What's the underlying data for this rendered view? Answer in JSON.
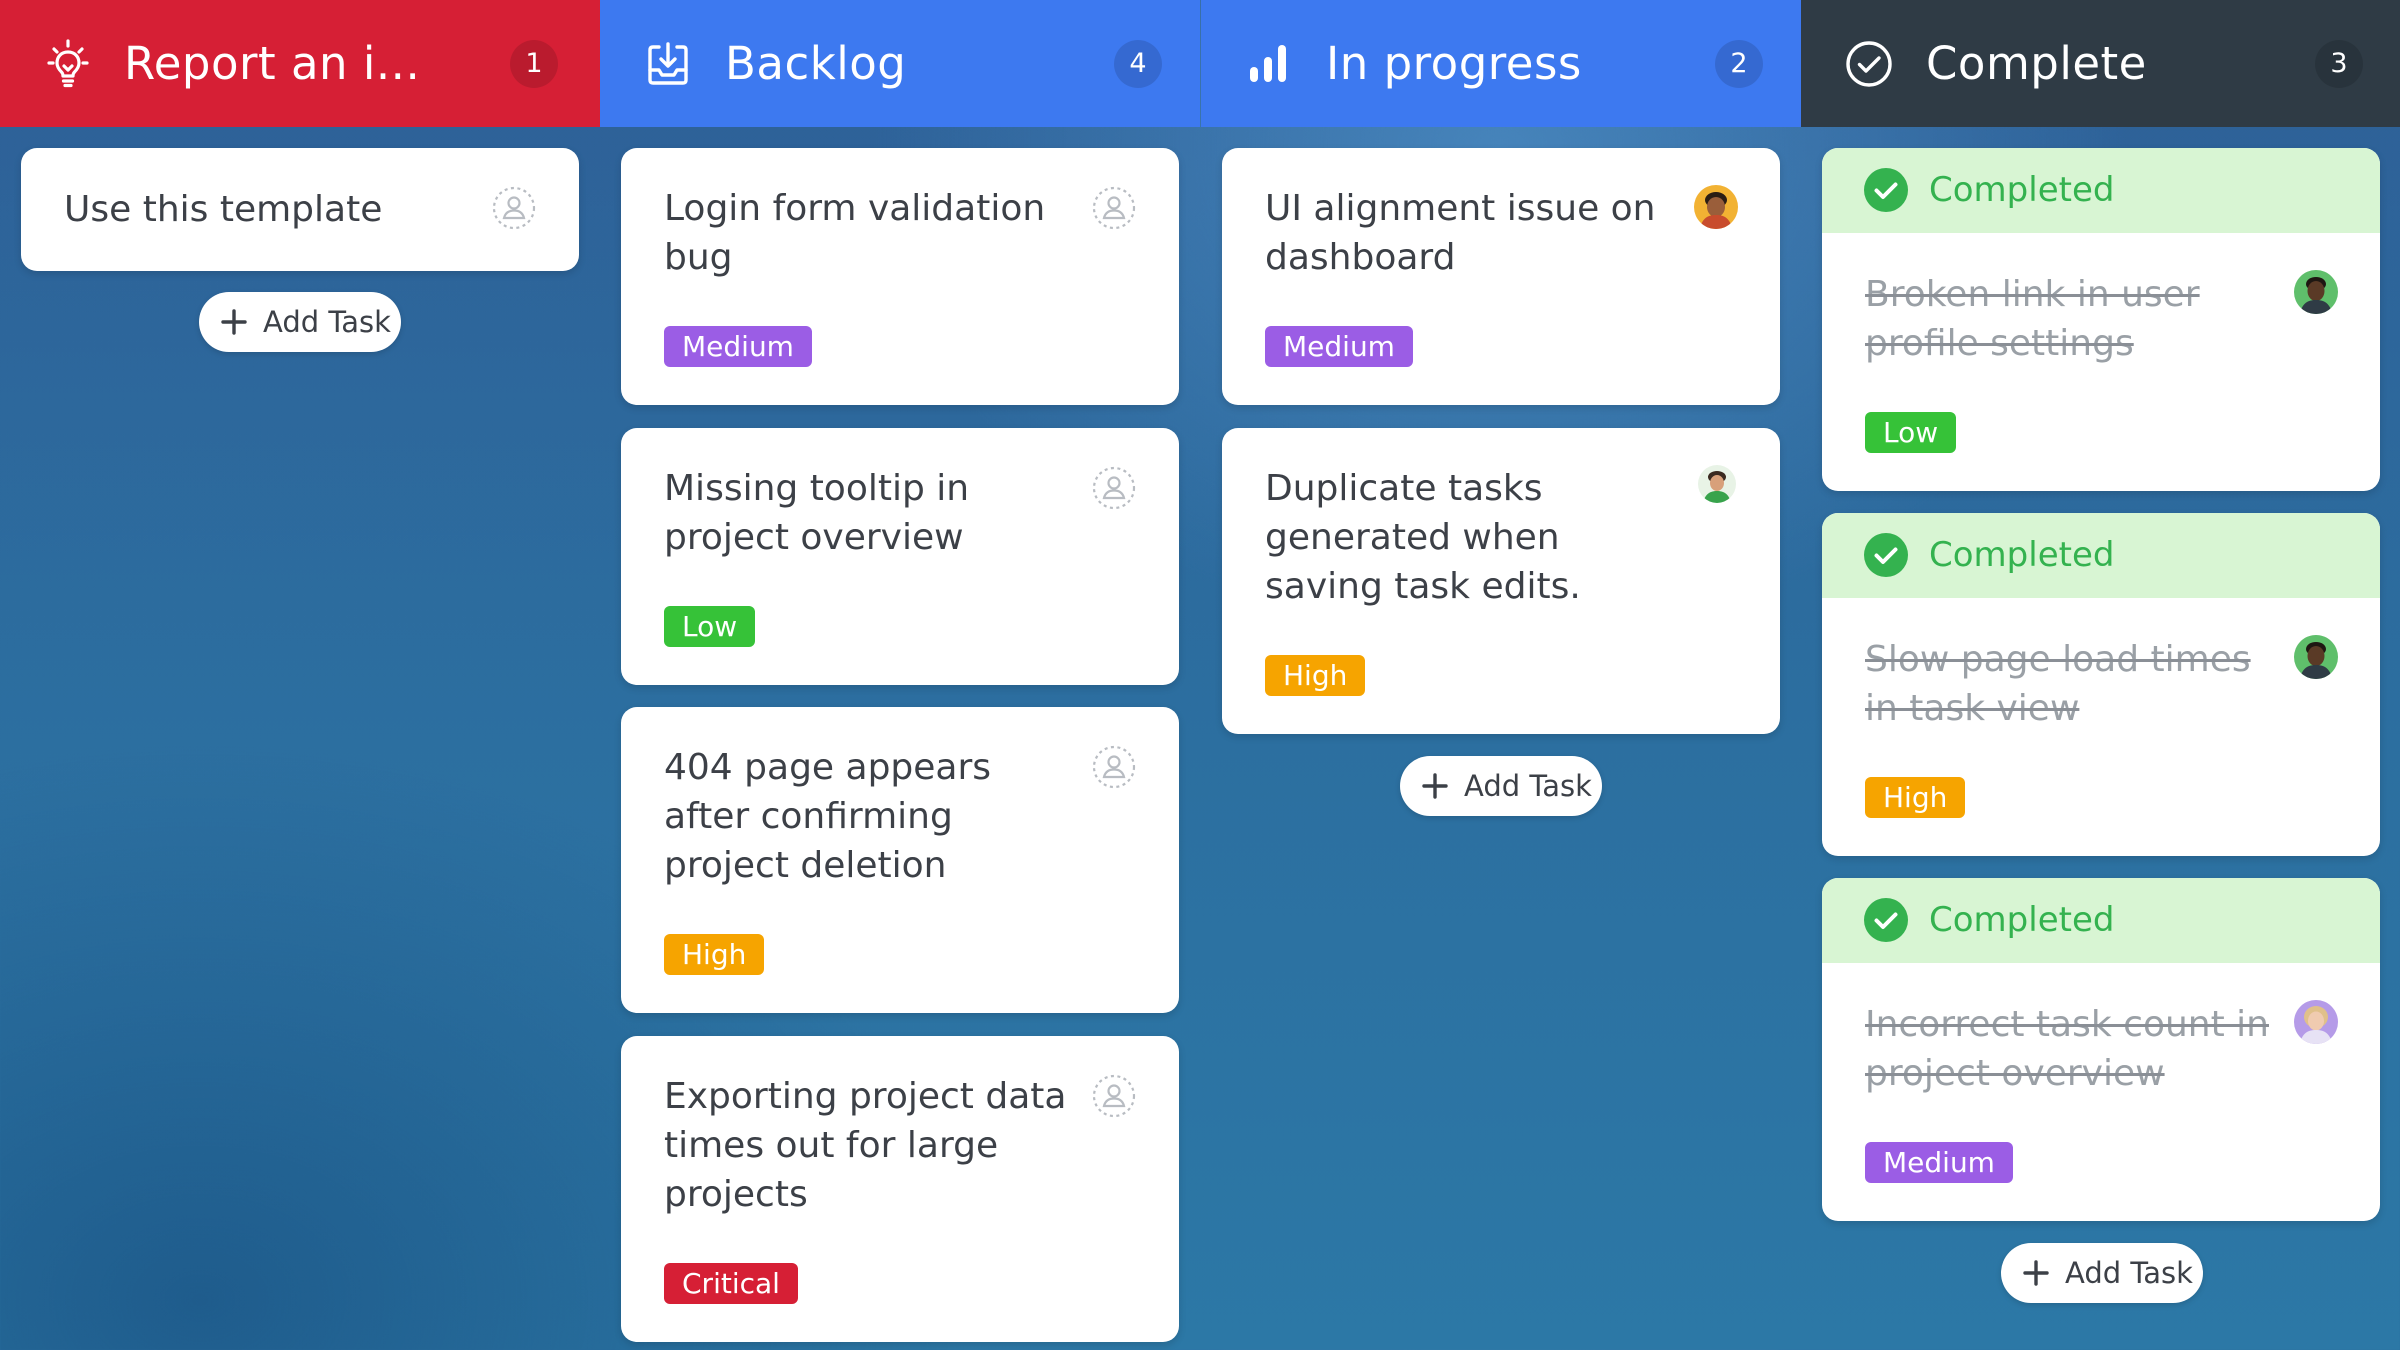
{
  "colors": {
    "report": "#d61f35",
    "backlog": "#3d79f0",
    "in_progress": "#3d79f0",
    "complete": "#2f3b45",
    "medium": "#9b5de5",
    "low": "#36c238",
    "high": "#f6a400",
    "critical": "#d61f35",
    "completed_banner": "#d8f5d3",
    "completed_text": "#34b24f"
  },
  "columns": [
    {
      "title": "Report an i...",
      "count": "1",
      "icon": "lightbulb-icon",
      "cards": [
        {
          "title": "Use this template",
          "assignee": "unassigned"
        }
      ],
      "add_task": "Add Task"
    },
    {
      "title": "Backlog",
      "count": "4",
      "icon": "inbox-download-icon",
      "cards": [
        {
          "title": "Login form validation bug",
          "priority": "Medium",
          "assignee": "unassigned"
        },
        {
          "title": "Missing tooltip in project overview",
          "priority": "Low",
          "assignee": "unassigned"
        },
        {
          "title": "404 page appears after confirming project deletion",
          "priority": "High",
          "assignee": "unassigned"
        },
        {
          "title": "Exporting project data times out for large projects",
          "priority": "Critical",
          "assignee": "unassigned"
        }
      ]
    },
    {
      "title": "In progress",
      "count": "2",
      "icon": "bar-chart-icon",
      "cards": [
        {
          "title": "UI alignment issue on dashboard",
          "priority": "Medium",
          "assignee": "avatar"
        },
        {
          "title": "Duplicate tasks generated when saving task edits.",
          "priority": "High",
          "assignee": "avatar"
        }
      ],
      "add_task": "Add Task"
    },
    {
      "title": "Complete",
      "count": "3",
      "icon": "check-circle-icon",
      "cards": [
        {
          "status": "Completed",
          "title": "Broken link in user profile settings",
          "priority": "Low",
          "assignee": "avatar"
        },
        {
          "status": "Completed",
          "title": "Slow page load times in task view",
          "priority": "High",
          "assignee": "avatar"
        },
        {
          "status": "Completed",
          "title": "Incorrect task count in project overview",
          "priority": "Medium",
          "assignee": "avatar"
        }
      ],
      "add_task": "Add Task"
    }
  ]
}
